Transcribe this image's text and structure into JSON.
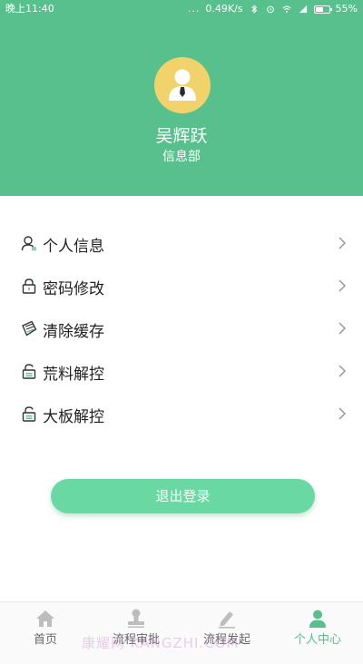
{
  "status_bar": {
    "time": "晚上11:40",
    "dots": "...",
    "network_speed": "0.49K/s",
    "battery_percent": "55%",
    "battery_level": 0.55,
    "icons": [
      "bluetooth-icon",
      "alarm-icon",
      "wifi-icon",
      "signal-icon",
      "battery-icon"
    ]
  },
  "profile": {
    "name": "吴辉跃",
    "department": "信息部",
    "avatar_color": "#f2d26b"
  },
  "menu": {
    "items": [
      {
        "label": "个人信息",
        "icon": "user-icon"
      },
      {
        "label": "密码修改",
        "icon": "lock-icon"
      },
      {
        "label": "清除缓存",
        "icon": "clear-cache-icon"
      },
      {
        "label": "荒料解控",
        "icon": "unlock-icon"
      },
      {
        "label": "大板解控",
        "icon": "unlock-icon"
      }
    ]
  },
  "logout": {
    "label": "退出登录"
  },
  "bottom_nav": {
    "items": [
      {
        "label": "首页",
        "icon": "home-icon",
        "active": false
      },
      {
        "label": "流程审批",
        "icon": "stamp-icon",
        "active": false
      },
      {
        "label": "流程发起",
        "icon": "edit-icon",
        "active": false
      },
      {
        "label": "个人中心",
        "icon": "profile-icon",
        "active": true
      }
    ]
  },
  "watermark": "康耀网 KANGZHI.COM",
  "colors": {
    "brand_green": "#57c08d",
    "button_green": "#6ad8a2",
    "nav_inactive": "#666666"
  }
}
